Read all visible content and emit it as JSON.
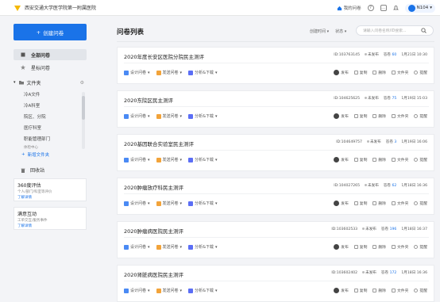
{
  "app": {
    "title": "西安交通大学医学院第一附属医院"
  },
  "topbar": {
    "my_survey": "我的问卷",
    "help_icon": "help-icon",
    "chat_icon": "chat-icon",
    "bell_icon": "bell-icon",
    "user_name": "N104",
    "user_caret": "▾"
  },
  "sidebar": {
    "create_label": "创建问卷",
    "all_label": "全部问卷",
    "starred_label": "星标问卷",
    "folder_label": "文件夹",
    "folders": [
      "冷A文件",
      "冷A科室",
      "院区、分院",
      "医疗科室",
      "职能管理部门",
      "体检中心"
    ],
    "new_folder_label": "新增文件夹",
    "recycle_label": "回收站",
    "promos": [
      {
        "title": "360度评估",
        "desc": "个人/部门/科室等评价",
        "link": "了解详情"
      },
      {
        "title": "满意互动",
        "desc": "工单交互/服务事件",
        "link": "了解详情"
      }
    ]
  },
  "main": {
    "title": "问卷列表",
    "sort_label": "创建时间 ▾",
    "status_label": "状态 ▾",
    "search_placeholder": "请输入问卷名称/ID搜索...",
    "action_labels": {
      "design": "设计问卷",
      "send": "发送问卷",
      "analyze": "分析&下载"
    },
    "op_labels": {
      "publish": "发布",
      "copy": "复制",
      "delete": "删除",
      "folder": "文件夹",
      "remind": "提醒"
    },
    "status_unpublished": "未发布",
    "answers_label": "答卷",
    "surveys": [
      {
        "title": "2020年度长安区医院分院民主测评",
        "id": "ID:103763145",
        "answers": "60",
        "date": "1月21日 10:30"
      },
      {
        "title": "2020东院区民主测评",
        "id": "ID:104625625",
        "answers": "75",
        "date": "1月19日 15:03"
      },
      {
        "title": "2020基因联合实验室民主测评",
        "id": "ID:104649757",
        "answers": "3",
        "date": "1月19日 16:06"
      },
      {
        "title": "2020肿瘤放疗科民主测评",
        "id": "ID:104027265",
        "answers": "62",
        "date": "1月18日 16:36"
      },
      {
        "title": "2020肿瘤病医院民主测评",
        "id": "ID:103602533",
        "answers": "196",
        "date": "1月18日 16:37"
      },
      {
        "title": "2020肾脏病医院民主测评",
        "id": "ID:103602402",
        "answers": "172",
        "date": "1月18日 16:36"
      }
    ]
  },
  "colors": {
    "accent": "#1a73e8",
    "logo": "#f5b800"
  }
}
